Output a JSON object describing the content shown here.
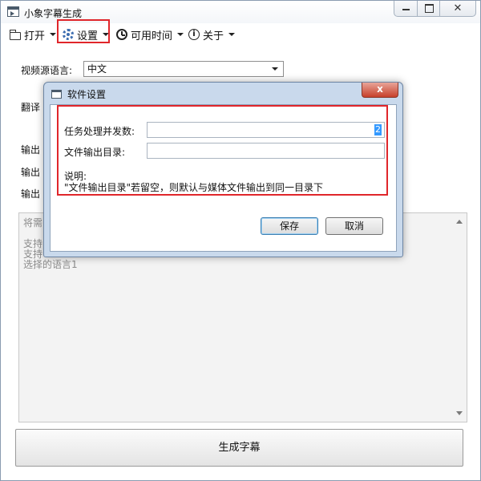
{
  "window": {
    "title": "小象字幕生成"
  },
  "menu": {
    "open": "打开",
    "settings": "设置",
    "available_time": "可用时间",
    "about": "关于"
  },
  "main": {
    "source_language_label": "视频源语言:",
    "source_language_value": "中文",
    "translate_label_partial": "翻译",
    "output_label_1_partial": "输出",
    "output_label_2_partial": "输出",
    "output_label_3_partial": "输出",
    "info_lines": [
      "将需",
      "支持",
      "支持",
      "选择的语言1"
    ],
    "generate_button": "生成字幕"
  },
  "dialog": {
    "title": "软件设置",
    "close_label": "x",
    "concurrency_label": "任务处理并发数:",
    "concurrency_value": "2",
    "output_dir_label": "文件输出目录:",
    "output_dir_value": "",
    "note_title": "说明:",
    "note_text": "\"文件输出目录\"若留空，则默认与媒体文件输出到同一目录下",
    "save_button": "保存",
    "cancel_button": "取消"
  }
}
